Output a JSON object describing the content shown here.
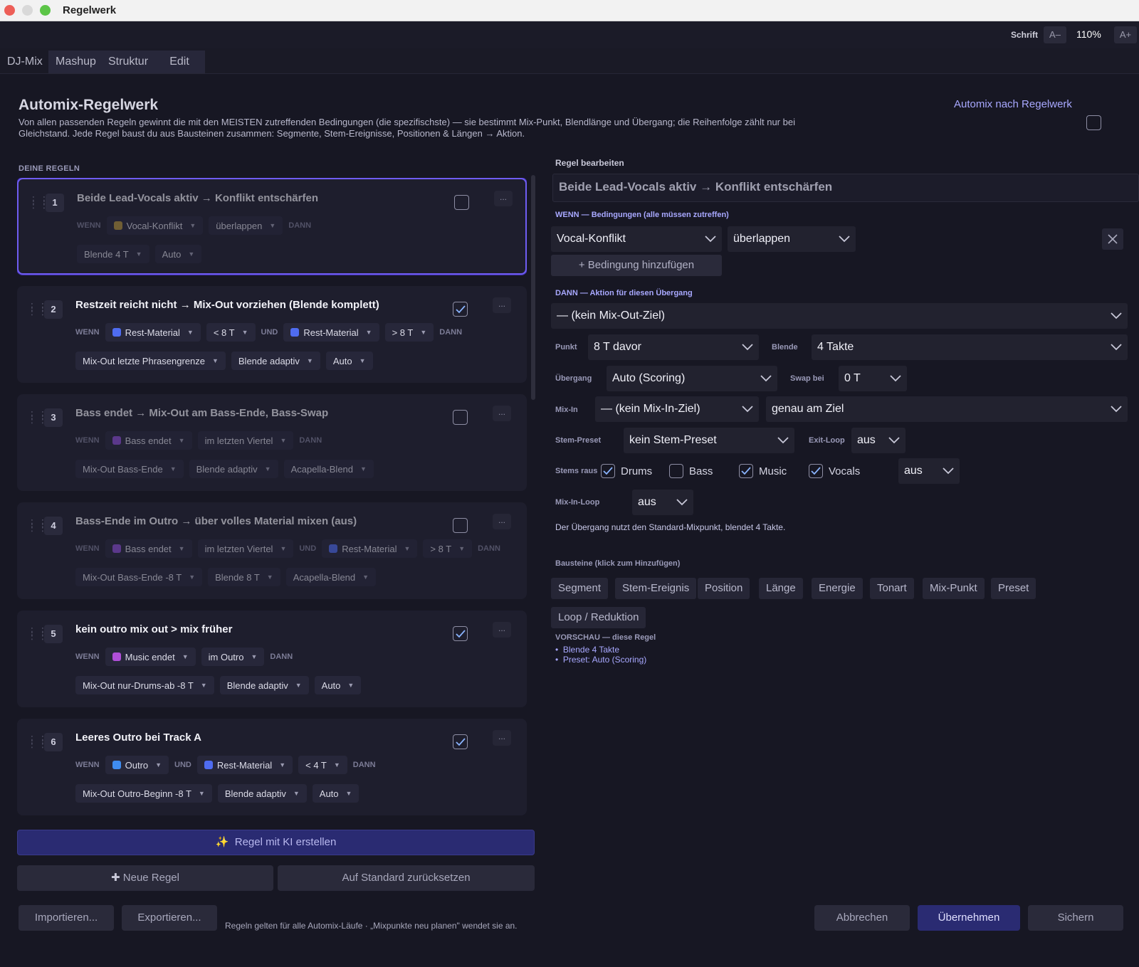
{
  "window": {
    "title": "Regelwerk"
  },
  "font_control": {
    "label": "Schrift",
    "decrease": "A–",
    "zoom": "110%",
    "increase": "A+"
  },
  "tabs": [
    "DJ-Mix",
    "Mashup",
    "Struktur",
    "Edit"
  ],
  "header": {
    "title": "Automix-Regelwerk",
    "description": "Von allen passenden Regeln gewinnt die mit den MEISTEN zutreffenden Bedingungen (die spezifischste) — sie bestimmt Mix-Punkt, Blendlänge und Übergang; die Reihenfolge zählt nur bei Gleichstand. Jede Regel baust du aus Bausteinen zusammen: Segmente, Stem-Ereignisse, Positionen & Längen → Aktion.",
    "automix_label": "Automix nach Regelwerk",
    "automix_enabled": false
  },
  "rules_section": {
    "label": "DEINE REGELN"
  },
  "keywords": {
    "wenn": "WENN",
    "und": "UND",
    "dann": "DANN"
  },
  "rules": [
    {
      "num": "1",
      "title": "Beide Lead-Vocals aktiv → Konflikt entschärfen",
      "enabled": false,
      "conds": [
        {
          "label": "Vocal-Konflikt",
          "color": "#b3943a"
        },
        {
          "label": "überlappen"
        }
      ],
      "actions": [
        "Blende 4 T",
        "Auto"
      ]
    },
    {
      "num": "2",
      "title": "Restzeit reicht nicht → Mix-Out vorziehen (Blende komplett)",
      "enabled": true,
      "conds": [
        {
          "label": "Rest-Material",
          "color": "#4f6cf0"
        },
        {
          "label": "< 8 T"
        },
        {
          "label": "Rest-Material",
          "color": "#4f6cf0",
          "und": true
        },
        {
          "label": "> 8 T"
        }
      ],
      "actions": [
        "Mix-Out letzte Phrasengrenze",
        "Blende adaptiv",
        "Auto"
      ]
    },
    {
      "num": "3",
      "title": "Bass endet → Mix-Out am Bass-Ende, Bass-Swap",
      "enabled": false,
      "conds": [
        {
          "label": "Bass endet",
          "color": "#8e4fd8"
        },
        {
          "label": "im letzten Viertel"
        }
      ],
      "actions": [
        "Mix-Out Bass-Ende",
        "Blende adaptiv",
        "Acapella-Blend"
      ]
    },
    {
      "num": "4",
      "title": "Bass-Ende im Outro → über volles Material mixen (aus)",
      "enabled": false,
      "conds": [
        {
          "label": "Bass endet",
          "color": "#8e4fd8"
        },
        {
          "label": "im letzten Viertel"
        },
        {
          "label": "Rest-Material",
          "color": "#4f6cf0",
          "und": true
        },
        {
          "label": "> 8 T"
        }
      ],
      "actions": [
        "Mix-Out Bass-Ende -8 T",
        "Blende 8 T",
        "Acapella-Blend"
      ]
    },
    {
      "num": "5",
      "title": "kein outro  mix out  > mix früher",
      "enabled": true,
      "conds": [
        {
          "label": "Music endet",
          "color": "#b04fd8"
        },
        {
          "label": "im Outro"
        }
      ],
      "actions": [
        "Mix-Out nur-Drums-ab -8 T",
        "Blende adaptiv",
        "Auto"
      ]
    },
    {
      "num": "6",
      "title": "Leeres Outro bei Track A",
      "enabled": true,
      "conds": [
        {
          "label": "Outro",
          "color": "#3f8cf0"
        },
        {
          "label": "Rest-Material",
          "color": "#4f6cf0",
          "und": true
        },
        {
          "label": "< 4 T"
        }
      ],
      "actions": [
        "Mix-Out Outro-Beginn -8 T",
        "Blende adaptiv",
        "Auto"
      ]
    }
  ],
  "more_label": "...",
  "buttons": {
    "ai": "Regel mit KI erstellen",
    "new": "Neue Regel",
    "reset": "Auf Standard zurücksetzen",
    "import": "Importieren...",
    "export": "Exportieren...",
    "cancel": "Abbrechen",
    "apply": "Übernehmen",
    "save": "Sichern"
  },
  "footnote": "Regeln gelten für alle Automix-Läufe · „Mixpunkte neu planen\" wendet sie an.",
  "editor": {
    "label": "Regel bearbeiten",
    "name": "Beide Lead-Vocals aktiv → Konflikt entschärfen",
    "wenn_label": "WENN  —  Bedingungen (alle müssen zutreffen)",
    "cond_type": "Vocal-Konflikt",
    "cond_op": "überlappen",
    "add_condition": "+ Bedingung hinzufügen",
    "dann_label": "DANN  —  Aktion für diesen Übergang",
    "mixout_target": "— (kein Mix-Out-Ziel)",
    "punkt_label": "Punkt",
    "punkt": "8 T davor",
    "blende_label": "Blende",
    "blende": "4 Takte",
    "uebergang_label": "Übergang",
    "uebergang": "Auto (Scoring)",
    "swap_label": "Swap bei",
    "swap": "0 T",
    "mixin_label": "Mix-In",
    "mixin_target": "— (kein Mix-In-Ziel)",
    "mixin_pos": "genau am Ziel",
    "stempreset_label": "Stem-Preset",
    "stempreset": "kein Stem-Preset",
    "exitloop_label": "Exit-Loop",
    "exitloop": "aus",
    "stems_label": "Stems raus",
    "stems": [
      {
        "label": "Drums",
        "on": true
      },
      {
        "label": "Bass",
        "on": false
      },
      {
        "label": "Music",
        "on": true
      },
      {
        "label": "Vocals",
        "on": true
      }
    ],
    "stems_mode": "aus",
    "mixinloop_label": "Mix-In-Loop",
    "mixinloop": "aus",
    "info": "Der Übergang nutzt den Standard-Mixpunkt, blendet 4 Takte.",
    "bausteine_label": "Bausteine (klick zum Hinzufügen)",
    "bausteine": [
      "Segment",
      "Stem-Ereignis",
      "Position",
      "Länge",
      "Energie",
      "Tonart",
      "Mix-Punkt",
      "Preset",
      "Loop / Reduktion"
    ],
    "preview_label": "VORSCHAU — diese Regel",
    "preview": [
      "Blende 4 Takte",
      "Preset: Auto (Scoring)"
    ]
  }
}
